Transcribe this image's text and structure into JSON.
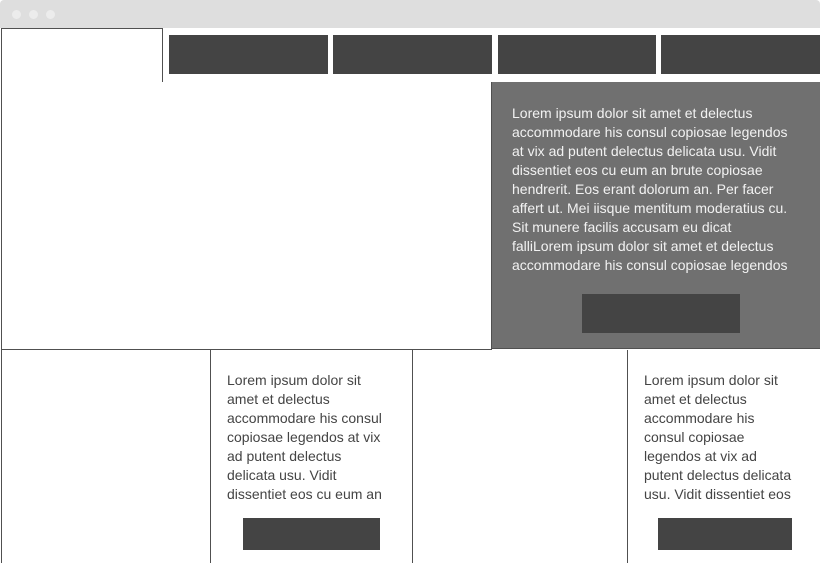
{
  "window": {
    "controls": [
      "close-dot",
      "minimize-dot",
      "maximize-dot"
    ]
  },
  "nav": {
    "tabs": [
      {
        "label": ""
      },
      {
        "label": ""
      },
      {
        "label": ""
      },
      {
        "label": ""
      }
    ]
  },
  "hero": {
    "text": "Lorem ipsum dolor sit amet et delectus\naccommodare his consul copiosae legendos\nat vix ad putent delectus delicata usu. Vidit\ndissentiet eos cu eum an brute copiosae\nhendrerit. Eos erant dolorum an. Per facer\naffert ut. Mei iisque mentitum moderatius cu.\nSit munere facilis accusam eu dicat\nfalliLorem ipsum dolor sit amet et delectus\naccommodare his consul copiosae legendos",
    "button_label": ""
  },
  "cards": [
    {
      "text": "Lorem ipsum dolor sit\namet et delectus\naccommodare his consul\ncopiosae legendos at vix\nad putent delectus\ndelicata usu. Vidit\ndissentiet eos cu eum an",
      "button_label": ""
    },
    {
      "text": "Lorem ipsum dolor sit\namet et delectus\naccommodare his\nconsul copiosae\nlegendos at vix ad\nputent delectus delicata\nusu. Vidit dissentiet eos",
      "button_label": ""
    }
  ],
  "colors": {
    "titlebar": "#dedede",
    "nav_tab": "#444444",
    "hero_panel": "#707070",
    "button": "#444444",
    "border": "#505050"
  }
}
